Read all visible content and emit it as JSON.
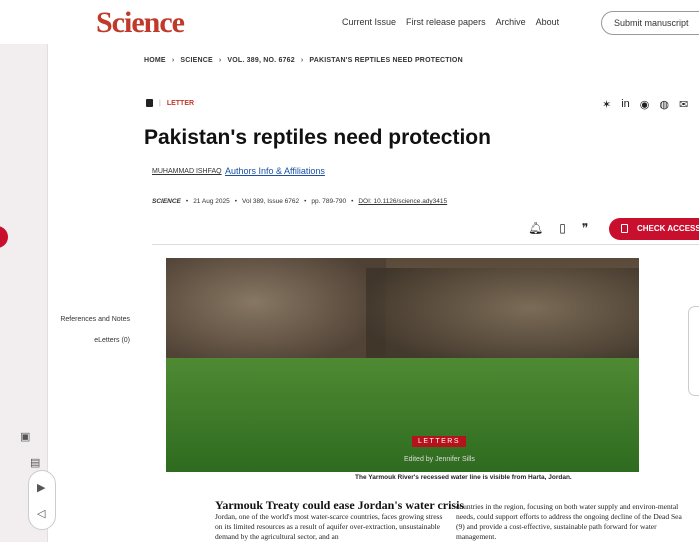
{
  "header": {
    "logo": "Science",
    "nav": [
      "Current Issue",
      "First release papers",
      "Archive",
      "About"
    ],
    "submit_label": "Submit manuscript"
  },
  "breadcrumb": [
    "HOME",
    "SCIENCE",
    "VOL. 389, NO. 6762",
    "PAKISTAN'S REPTILES NEED PROTECTION"
  ],
  "article": {
    "type": "LETTER",
    "title": "Pakistan's reptiles need protection",
    "author": "MUHAMMAD ISHFAQ",
    "affiliations_link": "Authors Info & Affiliations",
    "journal": "SCIENCE",
    "date": "21 Aug 2025",
    "volume": "Vol 389, Issue 6762",
    "pages": "pp. 789-790",
    "doi": "DOI: 10.1126/science.ady3415",
    "access_label": "CHECK ACCESS"
  },
  "toc": [
    "References and Notes",
    "eLetters (0)"
  ],
  "hero": {
    "tag": "LETTERS",
    "edited_by": "Edited by Jennifer Sills",
    "caption": "The Yarmouk River's recessed water line is visible from Harta, Jordan."
  },
  "preview": {
    "headline": "Yarmouk Treaty could ease Jordan's water crisis",
    "col1": "Jordan, one of the world's most water-scarce countries, faces growing stress on its limited resources as a result of aquifer over-extraction, unsustainable demand by the agricultural sector, and an",
    "col2": "countries in the region, focusing on both water supply and environ-mental needs, could support efforts to address the ongoing decline of the Dead Sea (9) and provide a cost-effective, sustainable path forward for water management."
  },
  "colors": {
    "accent": "#c8102e",
    "link": "#1a4fa3"
  }
}
